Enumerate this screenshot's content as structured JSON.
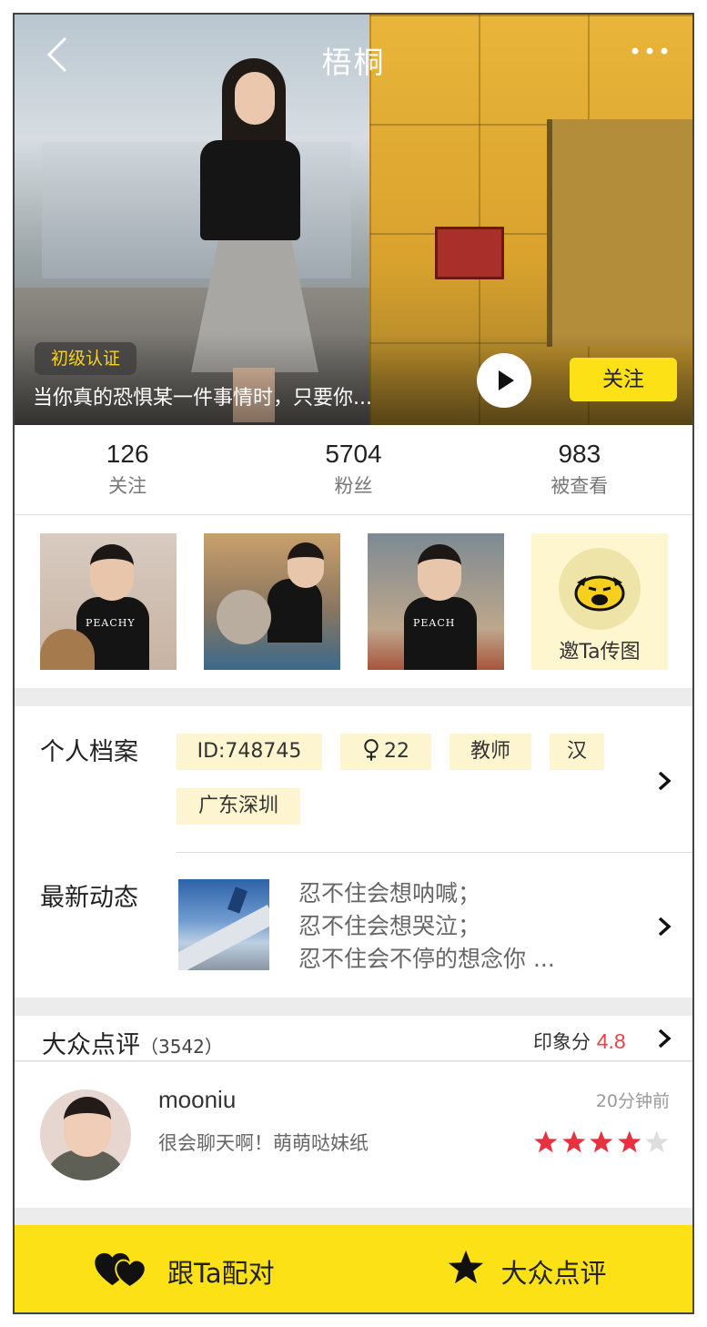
{
  "header": {
    "title": "梧桐",
    "cert_badge": "初级认证",
    "bio": "当你真的恐惧某一件事情时，只要你...",
    "follow_label": "关注"
  },
  "stats": [
    {
      "value": "126",
      "label": "关注"
    },
    {
      "value": "5704",
      "label": "粉丝"
    },
    {
      "value": "983",
      "label": "被查看"
    }
  ],
  "photos": {
    "items": [
      {
        "caption": "PEACHY"
      },
      {
        "caption": ""
      },
      {
        "caption": "PEACH"
      }
    ],
    "invite_label": "邀Ta传图"
  },
  "profile": {
    "title": "个人档案",
    "tags": [
      "ID:748745",
      "22",
      "教师",
      "汉",
      "广东深圳"
    ],
    "gender_icon": "female-icon"
  },
  "news": {
    "title": "最新动态",
    "lines": [
      "忍不住会想呐喊；",
      "忍不住会想哭泣；",
      "忍不住会不停的想念你 ..."
    ]
  },
  "reviews": {
    "title": "大众点评",
    "count": "（3542）",
    "score_label": "印象分",
    "score_value": "4.8",
    "items": [
      {
        "name": "mooniu",
        "time": "20分钟前",
        "text": "很会聊天啊！萌萌哒妹纸",
        "rating": 4,
        "max": 5
      }
    ]
  },
  "bottom": {
    "pair_label": "跟Ta配对",
    "review_label": "大众点评"
  },
  "colors": {
    "accent_yellow": "#fce117",
    "tag_bg": "#fdf5cf",
    "score_red": "#e9424c",
    "star_red": "#e8303f"
  }
}
